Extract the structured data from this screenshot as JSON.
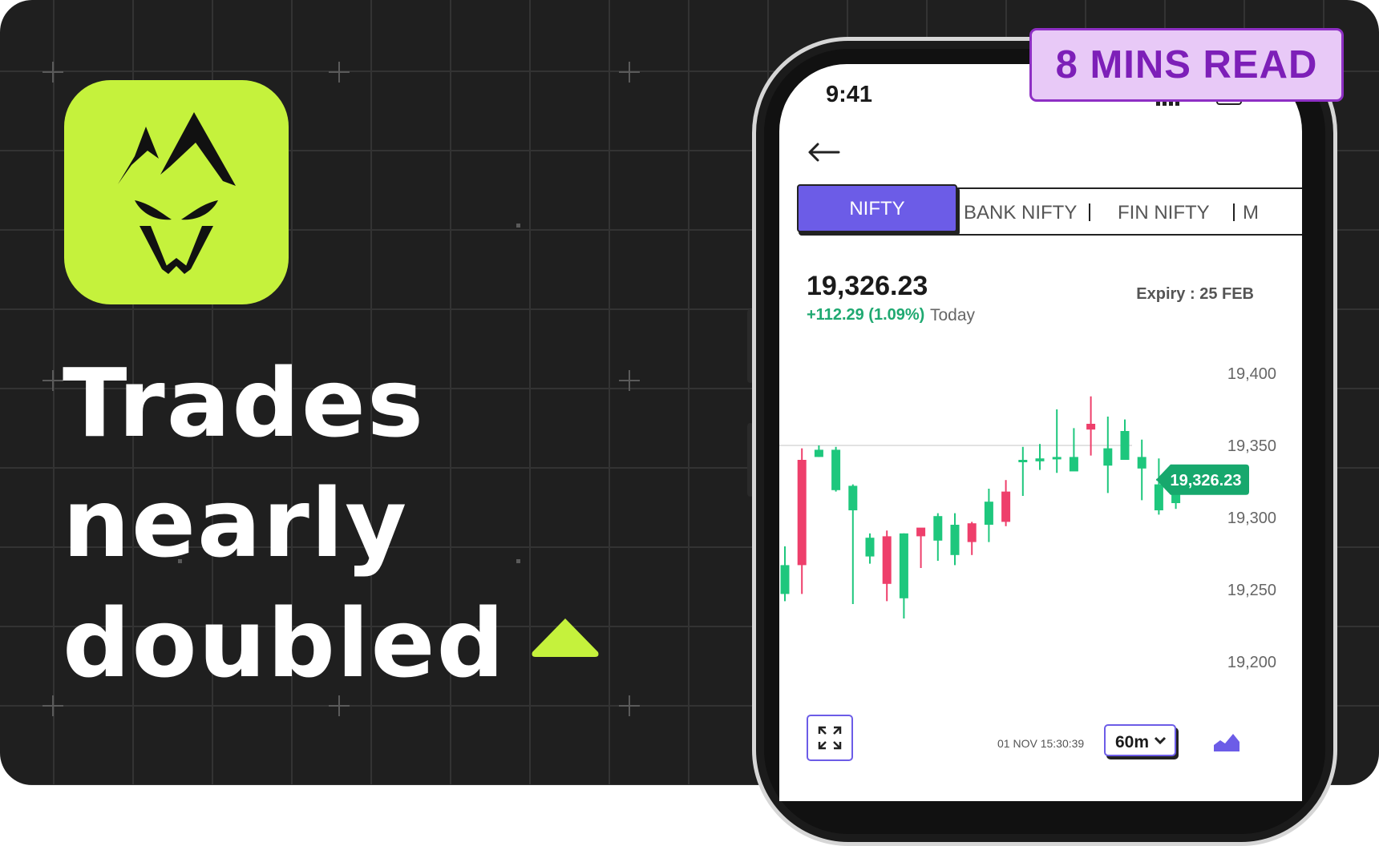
{
  "badge": {
    "read_time": "8 MINS READ"
  },
  "headline": {
    "line1": "Trades",
    "line2": "nearly",
    "line3": "doubled"
  },
  "colors": {
    "accent_lime": "#c5f23c",
    "accent_purple": "#6c5ce7",
    "bull": "#1ec77d",
    "bear": "#ee3f6b",
    "badge_text": "#7d1fb8"
  },
  "phone": {
    "status_time": "9:41",
    "tabs": [
      {
        "label": "NIFTY",
        "active": true
      },
      {
        "label": "BANK NIFTY",
        "active": false
      },
      {
        "label": "FIN NIFTY",
        "active": false
      },
      {
        "label": "M",
        "active": false
      }
    ],
    "price": "19,326.23",
    "change": "+112.29 (1.09%)",
    "change_period": "Today",
    "expiry": "Expiry : 25 FEB",
    "current_label": "19,326.23",
    "timestamp": "01 NOV 15:30:39",
    "interval": "60m"
  },
  "chart_data": {
    "type": "candlestick",
    "y_ticks": [
      "19,400",
      "19,350",
      "19,300",
      "19,250",
      "19,200"
    ],
    "ylim": [
      19200,
      19400
    ],
    "reference_line": 19350,
    "current_price": 19326.23,
    "candles": [
      {
        "open": 19247,
        "close": 19267,
        "high": 19280,
        "low": 19242
      },
      {
        "open": 19340,
        "close": 19267,
        "high": 19348,
        "low": 19247
      },
      {
        "open": 19342,
        "close": 19347,
        "high": 19350,
        "low": 19342
      },
      {
        "open": 19319,
        "close": 19347,
        "high": 19349,
        "low": 19318
      },
      {
        "open": 19305,
        "close": 19322,
        "high": 19323,
        "low": 19240
      },
      {
        "open": 19273,
        "close": 19286,
        "high": 19289,
        "low": 19268
      },
      {
        "open": 19287,
        "close": 19254,
        "high": 19291,
        "low": 19242
      },
      {
        "open": 19244,
        "close": 19289,
        "high": 19289,
        "low": 19230
      },
      {
        "open": 19293,
        "close": 19287,
        "high": 19288,
        "low": 19265
      },
      {
        "open": 19284,
        "close": 19301,
        "high": 19303,
        "low": 19270
      },
      {
        "open": 19274,
        "close": 19295,
        "high": 19303,
        "low": 19267
      },
      {
        "open": 19296,
        "close": 19283,
        "high": 19297,
        "low": 19274
      },
      {
        "open": 19295,
        "close": 19311,
        "high": 19320,
        "low": 19283
      },
      {
        "open": 19318,
        "close": 19297,
        "high": 19326,
        "low": 19294
      },
      {
        "open": 19339,
        "close": 19340,
        "high": 19349,
        "low": 19315
      },
      {
        "open": 19339,
        "close": 19341,
        "high": 19351,
        "low": 19333
      },
      {
        "open": 19341,
        "close": 19342,
        "high": 19375,
        "low": 19331
      },
      {
        "open": 19332,
        "close": 19342,
        "high": 19362,
        "low": 19334
      },
      {
        "open": 19365,
        "close": 19361,
        "high": 19384,
        "low": 19343
      },
      {
        "open": 19336,
        "close": 19348,
        "high": 19370,
        "low": 19317
      },
      {
        "open": 19340,
        "close": 19360,
        "high": 19368,
        "low": 19340
      },
      {
        "open": 19334,
        "close": 19342,
        "high": 19354,
        "low": 19312
      },
      {
        "open": 19305,
        "close": 19323,
        "high": 19341,
        "low": 19302
      },
      {
        "open": 19310,
        "close": 19325,
        "high": 19328,
        "low": 19306
      }
    ]
  }
}
